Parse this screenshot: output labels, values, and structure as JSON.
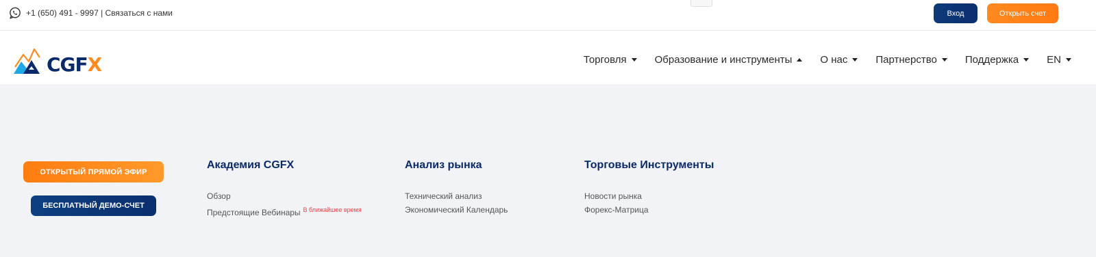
{
  "topbar": {
    "phone_contact": "+1 (650) 491 - 9997 | Связаться с нами",
    "login_label": "Вход",
    "open_account_label": "Открыть счет"
  },
  "brand": {
    "logo_text_main": "CGF",
    "logo_text_x": "X",
    "colors": {
      "navy": "#0b2a6b",
      "orange": "#ff8a1f",
      "cyan": "#1fa7e6"
    }
  },
  "nav": {
    "items": [
      {
        "label": "Торговля",
        "caret": "down"
      },
      {
        "label": "Образование и инструменты",
        "caret": "up"
      },
      {
        "label": "О нас",
        "caret": "down"
      },
      {
        "label": "Партнерство",
        "caret": "down"
      },
      {
        "label": "Поддержка",
        "caret": "down"
      },
      {
        "label": "EN",
        "caret": "down"
      }
    ]
  },
  "cta": {
    "live_label": "ОТКРЫТЫЙ ПРЯМОЙ ЭФИР",
    "demo_label": "БЕСПЛАТНЫЙ ДЕМО-СЧЕТ"
  },
  "columns": [
    {
      "title": "Академия CGFX",
      "links": [
        "Обзор",
        "Предстоящие Вебинары"
      ],
      "badge": "В ближайшее время"
    },
    {
      "title": "Анализ рынка",
      "links": [
        "Технический анализ",
        "Экономический Календарь"
      ]
    },
    {
      "title": "Торговые Инструменты",
      "links": [
        "Новости рынка",
        "Форекс-Матрица"
      ]
    }
  ]
}
